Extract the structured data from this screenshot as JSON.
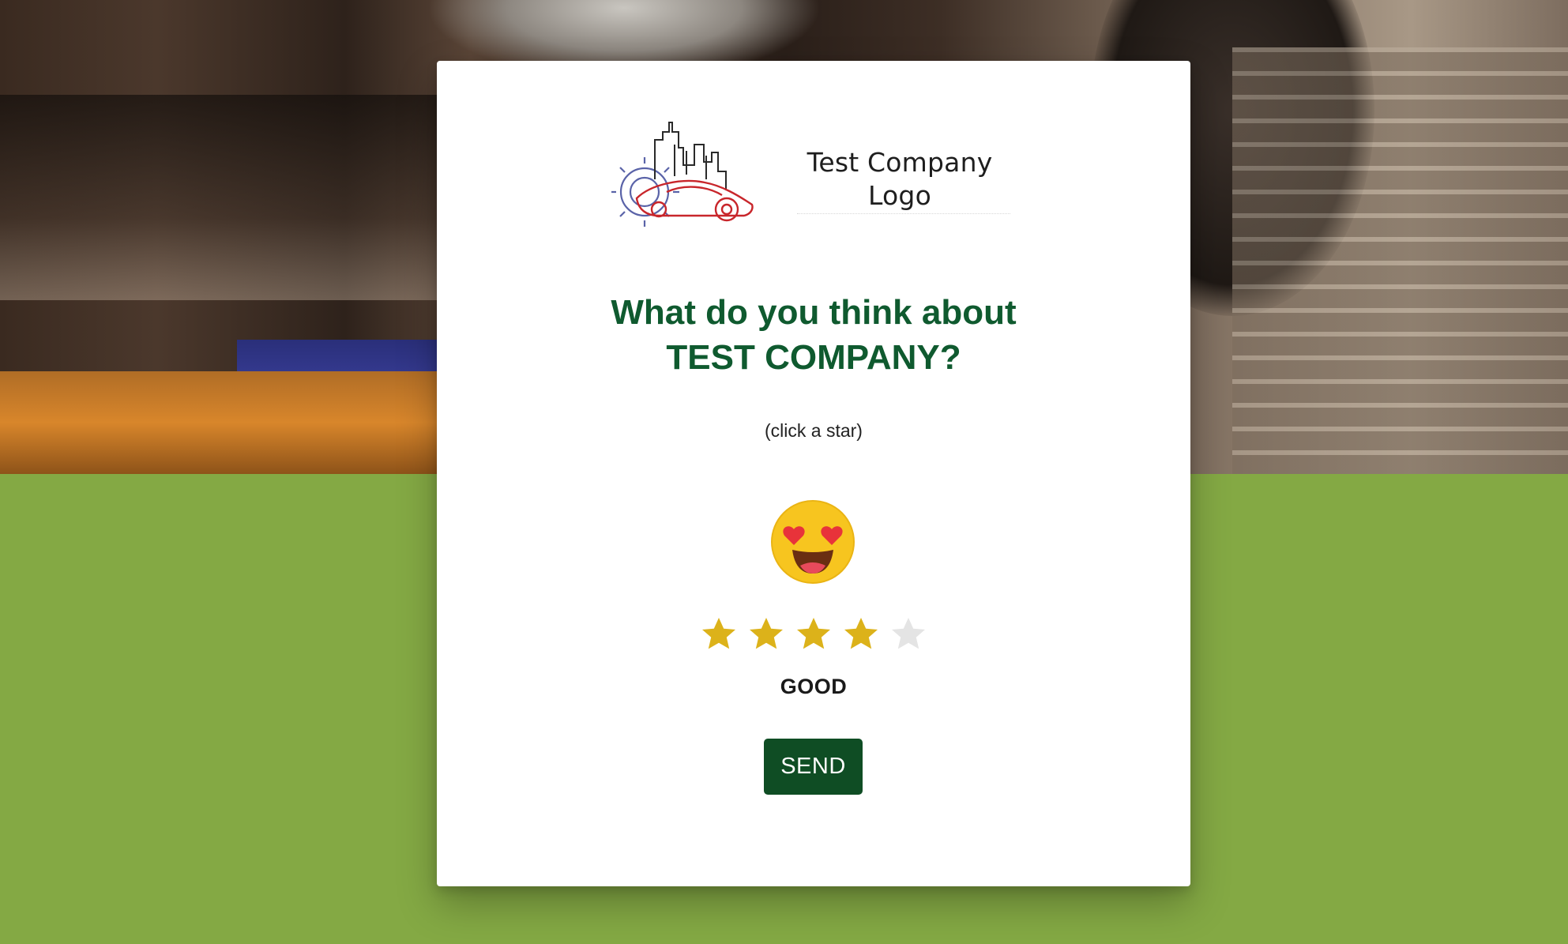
{
  "logo": {
    "line1": "Test Company",
    "line2": "Logo"
  },
  "survey": {
    "question_line1": "What do you think about",
    "question_line2": "TEST COMPANY?",
    "hint": "(click a star)",
    "emoji_icon": "heart-eyes-face-icon",
    "rating": {
      "selected": 4,
      "max": 5
    },
    "rating_label": "GOOD",
    "send_label": "SEND"
  },
  "colors": {
    "page_green": "#84a944",
    "heading_green": "#0f5a2f",
    "button_green": "#0f4d24",
    "star_filled": "#dcb21a",
    "star_empty": "#e4e4e4"
  }
}
